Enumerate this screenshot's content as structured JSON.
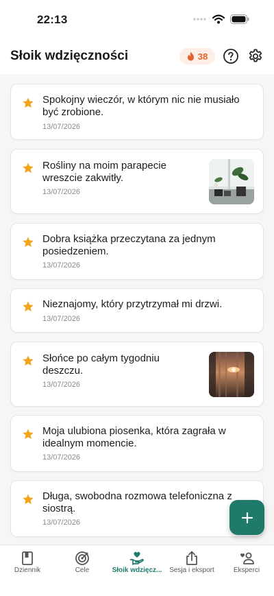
{
  "status_bar": {
    "time": "22:13"
  },
  "header": {
    "title": "Słoik wdzięczności",
    "streak_count": "38",
    "help_icon": "question-circle-icon",
    "settings_icon": "gear-icon"
  },
  "colors": {
    "accent": "#1f7a6c",
    "star": "#f2a51a",
    "streak": "#e2622a",
    "streak_bg": "#fdeee6"
  },
  "entries": [
    {
      "text": "Spokojny wieczór, w którym nic nie musiało być zrobione.",
      "date": "13/07/2026",
      "has_image": false
    },
    {
      "text": "Rośliny na moim parapecie wreszcie zakwitły.",
      "date": "13/07/2026",
      "has_image": true,
      "image": "plants-on-windowsill-photo"
    },
    {
      "text": "Dobra książka przeczytana za jednym posiedzeniem.",
      "date": "13/07/2026",
      "has_image": false
    },
    {
      "text": "Nieznajomy, który przytrzymał mi drzwi.",
      "date": "13/07/2026",
      "has_image": false
    },
    {
      "text": "Słońce po całym tygodniu deszczu.",
      "date": "13/07/2026",
      "has_image": true,
      "image": "sunset-through-curtains-photo"
    },
    {
      "text": "Moja ulubiona piosenka, która zagrała w idealnym momencie.",
      "date": "13/07/2026",
      "has_image": false
    },
    {
      "text": "Długa, swobodna rozmowa telefoniczna z siostrą.",
      "date": "13/07/2026",
      "has_image": false
    }
  ],
  "fab": {
    "icon": "plus-icon"
  },
  "tabs": [
    {
      "label": "Dziennik",
      "icon": "journal-icon",
      "active": false
    },
    {
      "label": "Cele",
      "icon": "target-icon",
      "active": false
    },
    {
      "label": "Słoik wdzięcz...",
      "icon": "heart-hand-icon",
      "active": true
    },
    {
      "label": "Sesja i eksport",
      "icon": "share-icon",
      "active": false
    },
    {
      "label": "Eksperci",
      "icon": "experts-icon",
      "active": false
    }
  ]
}
